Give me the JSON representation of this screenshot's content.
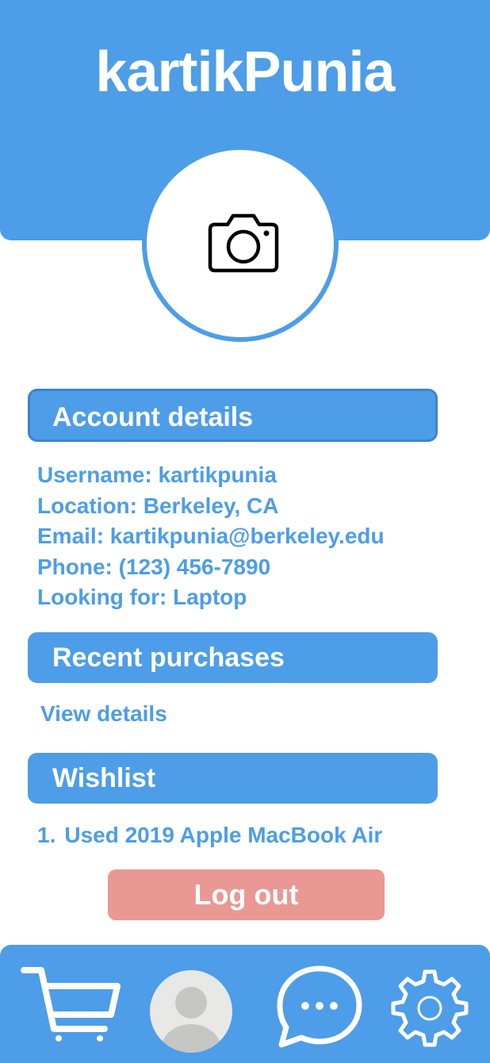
{
  "header": {
    "title": "kartikPunia",
    "avatar_icon": "camera-icon"
  },
  "account": {
    "heading": "Account details",
    "username": "Username: kartikpunia",
    "location": "Location: Berkeley, CA",
    "email": "Email: kartikpunia@berkeley.edu",
    "phone": "Phone: (123) 456-7890",
    "looking_for": "Looking for: Laptop"
  },
  "purchases": {
    "heading": "Recent purchases",
    "link": "View details"
  },
  "wishlist": {
    "heading": "Wishlist",
    "items": [
      {
        "number": "1.",
        "text": "Used 2019 Apple MacBook Air"
      }
    ]
  },
  "logout_label": "Log out",
  "nav": {
    "items": [
      "cart-icon",
      "profile-avatar-icon",
      "chat-icon",
      "settings-gear-icon"
    ]
  },
  "colors": {
    "primary": "#4d9de8",
    "logout": "#ea9894",
    "background": "#ffffff",
    "avatar_placeholder": "#e8e8e6"
  }
}
